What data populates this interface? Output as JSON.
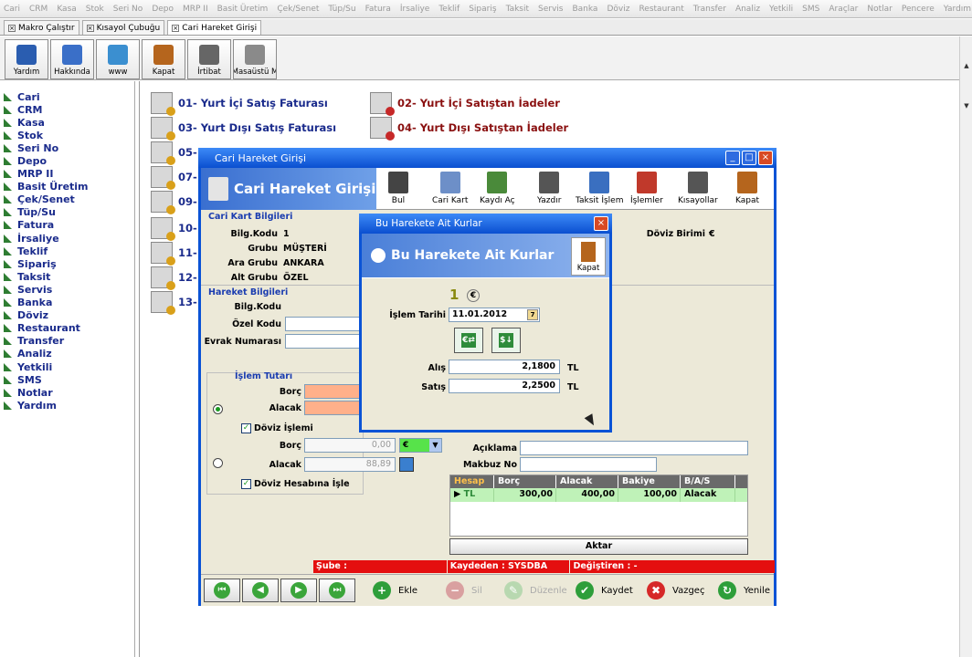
{
  "menubar": [
    "Cari",
    "CRM",
    "Kasa",
    "Stok",
    "Seri No",
    "Depo",
    "MRP II",
    "Basit Üretim",
    "Çek/Senet",
    "Tüp/Su",
    "Fatura",
    "İrsaliye",
    "Teklif",
    "Sipariş",
    "Taksit",
    "Servis",
    "Banka",
    "Döviz",
    "Restaurant",
    "Transfer",
    "Analiz",
    "Yetkili",
    "SMS",
    "Araçlar",
    "Notlar",
    "Pencere",
    "Yardım"
  ],
  "tabs": [
    {
      "label": "Makro Çalıştır"
    },
    {
      "label": "Kısayol Çubuğu"
    },
    {
      "label": "Cari Hareket Girişi"
    }
  ],
  "toolbar": [
    {
      "label": "Yardım",
      "icon": "help-icon",
      "color": "#2a5db0"
    },
    {
      "label": "Hakkında",
      "icon": "company-logo-icon",
      "color": "#3a6fc8"
    },
    {
      "label": "www",
      "icon": "globe-icon",
      "color": "#3b8fd0"
    },
    {
      "label": "Kapat",
      "icon": "door-exit-icon",
      "color": "#b5651d"
    },
    {
      "label": "İrtibat",
      "icon": "telephone-icon",
      "color": "#666666"
    },
    {
      "label": "Masaüstü M",
      "icon": "desktop-icon",
      "color": "#8a8a8a"
    }
  ],
  "sidebar": [
    "Cari",
    "CRM",
    "Kasa",
    "Stok",
    "Seri No",
    "Depo",
    "MRP II",
    "Basit Üretim",
    "Çek/Senet",
    "Tüp/Su",
    "Fatura",
    "İrsaliye",
    "Teklif",
    "Sipariş",
    "Taksit",
    "Servis",
    "Banka",
    "Döviz",
    "Restaurant",
    "Transfer",
    "Analiz",
    "Yetkili",
    "SMS",
    "Notlar",
    "Yardım"
  ],
  "documents_left": [
    "01- Yurt İçi Satış Faturası",
    "03- Yurt Dışı Satış Faturası",
    "05-",
    "07-",
    "09-",
    "10-",
    "11-",
    "12-",
    "13-"
  ],
  "documents_right": [
    "02- Yurt İçi Satıştan İadeler",
    "04- Yurt Dışı Satıştan İadeler"
  ],
  "window": {
    "title": "Cari Hareket Girişi",
    "banner_title": "Cari Hareket Girişi",
    "buttons": [
      "Bul",
      "Cari Kart",
      "Kaydı Aç",
      "Yazdır",
      "Taksit İşlem",
      "İşlemler",
      "Kısayollar",
      "Kapat"
    ],
    "cari_section": "Cari Kart Bilgileri",
    "bilg_kodu_label": "Bilg.Kodu",
    "bilg_kodu": "1",
    "grubu_label": "Grubu",
    "grubu": "MÜŞTERİ",
    "ara_grubu_label": "Ara Grubu",
    "ara_grubu": "ANKARA",
    "alt_grubu_label": "Alt Grubu",
    "alt_grubu": "ÖZEL",
    "doviz_birimi_label": "Döviz Birimi",
    "doviz_birimi": "€",
    "hareket_section": "Hareket Bilgileri",
    "h_bilg_kodu_label": "Bilg.Kodu",
    "ozel_kodu_label": "Özel Kodu",
    "evrak_label": "Evrak Numarası",
    "islem_tutari_label": "İşlem Tutarı",
    "borc_label": "Borç",
    "alacak_label": "Alacak",
    "doviz_islemi_label": "Döviz İşlemi",
    "doviz_borc_label": "Borç",
    "doviz_borc": "0,00",
    "doviz_alacak_label": "Alacak",
    "doviz_alacak": "88,89",
    "doviz_currency": "€",
    "doviz_hesaba_label": "Döviz Hesabına İşle",
    "aciklama_label": "Açıklama",
    "makbuz_label": "Makbuz No",
    "grid_headers": [
      "Hesap",
      "Borç",
      "Alacak",
      "Bakiye",
      "B/A/S"
    ],
    "grid_row": [
      "TL",
      "300,00",
      "400,00",
      "100,00",
      "Alacak"
    ],
    "aktar": "Aktar",
    "status": [
      "Şube :",
      "Kaydeden : SYSDBA",
      "Değiştiren :  -"
    ],
    "actions": [
      {
        "label": "Ekle",
        "icon": "add-icon",
        "color": "#2e9e3a",
        "glyph": "+"
      },
      {
        "label": "Sil",
        "icon": "delete-icon",
        "color": "#d9a0a0",
        "glyph": "−"
      },
      {
        "label": "Düzenle",
        "icon": "edit-icon",
        "color": "#b8d8b0",
        "glyph": "✎"
      },
      {
        "label": "Kaydet",
        "icon": "checkmark-icon",
        "color": "#2e9e3a",
        "glyph": "✔"
      },
      {
        "label": "Vazgeç",
        "icon": "cancel-icon",
        "color": "#d62828",
        "glyph": "✖"
      },
      {
        "label": "Yenile",
        "icon": "refresh-icon",
        "color": "#2e9e3a",
        "glyph": "↻"
      }
    ]
  },
  "dialog": {
    "title": "Bu Harekete Ait Kurlar",
    "banner": "Bu Harekete Ait Kurlar",
    "kapat": "Kapat",
    "number": "1",
    "currency": "€",
    "islem_tarihi_label": "İşlem Tarihi",
    "islem_tarihi": "11.01.2012",
    "alis_label": "Alış",
    "alis": "2,1800",
    "alis_unit": "TL",
    "satis_label": "Satış",
    "satis": "2,2500",
    "satis_unit": "TL"
  }
}
